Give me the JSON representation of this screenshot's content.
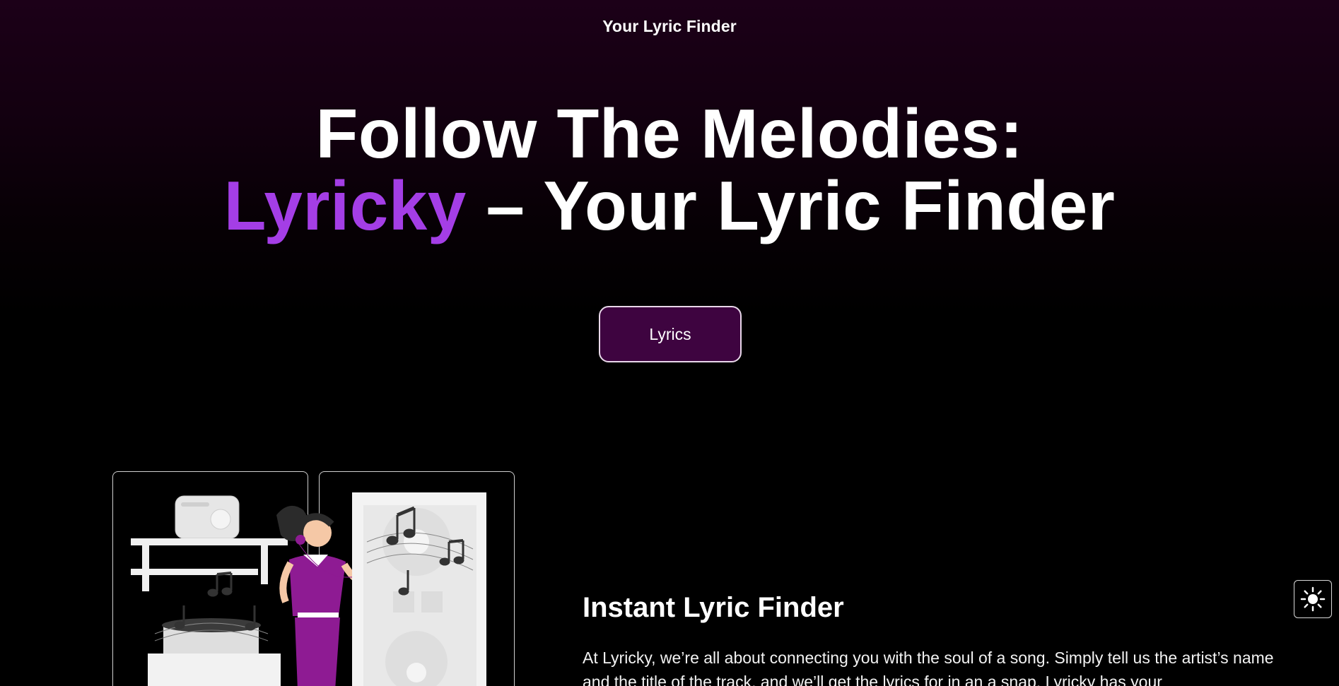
{
  "header": {
    "title": "Your Lyric Finder"
  },
  "hero": {
    "line1": "Follow The Melodies:",
    "brand": "Lyricky",
    "line2_rest": " – Your Lyric Finder"
  },
  "cta": {
    "label": "Lyrics"
  },
  "feature": {
    "title": "Instant Lyric Finder",
    "body": "At Lyricky, we’re all about connecting you with the soul of a song. Simply tell us the artist’s name and the title of the track, and we’ll get the lyrics for in an a snap. Lyricky has your"
  },
  "theme_toggle": {
    "icon": "sun-icon"
  },
  "colors": {
    "accent": "#a43ee6",
    "button_bg": "#3e0440",
    "background": "#000000",
    "header_gradient_top": "#1c0018"
  }
}
